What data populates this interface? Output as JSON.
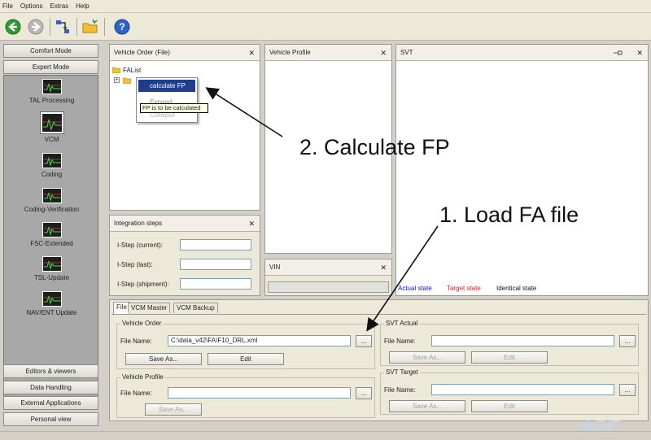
{
  "menubar": [
    "File",
    "Options",
    "Extras",
    "Help"
  ],
  "sidebar": {
    "modes": [
      "Comfort Mode",
      "Expert Mode"
    ],
    "tools": [
      "TAL Processing",
      "VCM",
      "Coding",
      "Coding-Verification",
      "FSC-Extended",
      "TSL-Update",
      "NAV/ENT Update"
    ],
    "bottom_buttons": [
      "Editors & viewers",
      "Data Handling",
      "External Applications",
      "Personal view"
    ]
  },
  "panels": {
    "vehicle_order": {
      "title": "Vehicle Order (File)",
      "tree_root": "FAList"
    },
    "vehicle_profile": {
      "title": "Vehicle Profile"
    },
    "svt": {
      "title": "SVT"
    },
    "vin": {
      "title": "VIN"
    },
    "integration": {
      "title": "Integration steps",
      "labels": [
        "I-Step (current):",
        "I-Step (last):",
        "I-Step (shipment):"
      ]
    }
  },
  "context_menu": {
    "items": [
      "calculate FP",
      "Expand",
      "Collapse"
    ],
    "tooltip": "FP is to be calculated"
  },
  "svt_legend": {
    "actual": "Actual state",
    "target": "Target state",
    "identical": "Identical state"
  },
  "bottom": {
    "tabs": [
      "File",
      "VCM Master",
      "VCM Backup"
    ],
    "vehicle_order_group": "Vehicle Order",
    "file_name_label": "File Name:",
    "file_name_value": "C:\\data_v42\\FA\\F10_DRL.xml",
    "browse": "...",
    "save_as": "Save As...",
    "edit": "Edit",
    "vehicle_profile_group": "Vehicle Profile",
    "svt_actual_group": "SVT Actual",
    "svt_target_group": "SVT Target"
  },
  "annotations": {
    "step2": "2. Calculate FP",
    "step1": "1. Load FA file"
  },
  "watermark": "实马汇",
  "colors": {
    "actual": "#1010ff",
    "target": "#e02020",
    "identical": "#111111"
  }
}
